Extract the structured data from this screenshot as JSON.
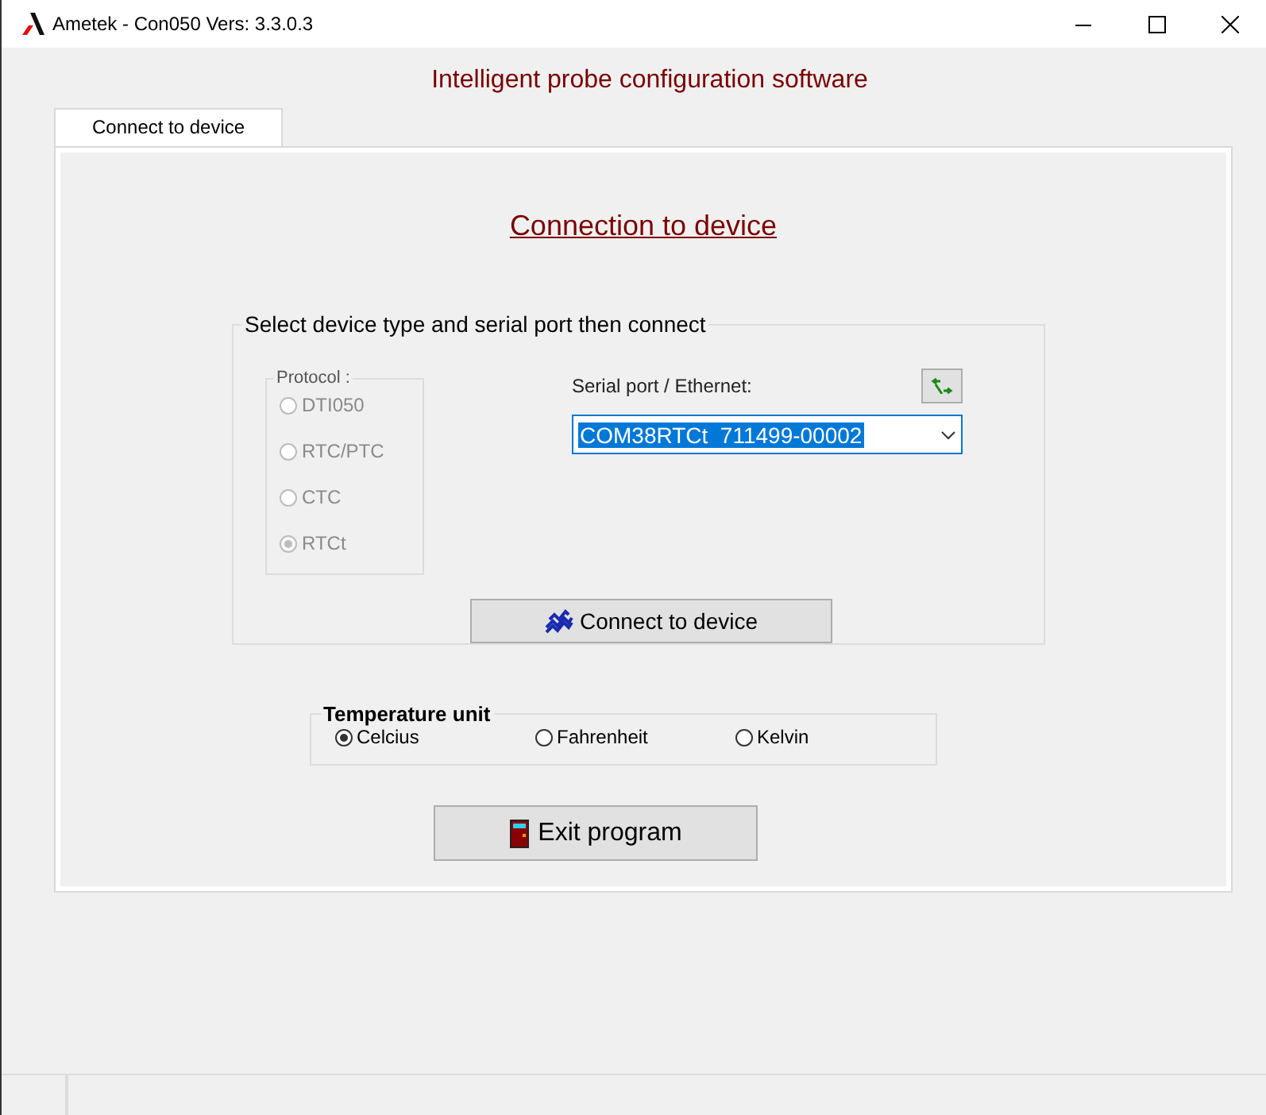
{
  "window": {
    "title": "Ametek - Con050 Vers: 3.3.0.3"
  },
  "heading": "Intelligent probe configuration software",
  "tabs": [
    {
      "label": "Connect to device",
      "selected": true
    }
  ],
  "panel_title": "Connection to device",
  "device_group": {
    "legend": "Select device type and serial port then connect",
    "protocol": {
      "legend": "Protocol :",
      "options": [
        {
          "label": "DTI050",
          "selected": false,
          "disabled": true
        },
        {
          "label": "RTC/PTC",
          "selected": false,
          "disabled": true
        },
        {
          "label": "CTC",
          "selected": false,
          "disabled": true
        },
        {
          "label": "RTCt",
          "selected": true,
          "disabled": true
        }
      ]
    },
    "port_label": "Serial port / Ethernet:",
    "port_value": "COM38RTCt  711499-00002",
    "connect_button": "Connect to device"
  },
  "temperature_group": {
    "legend": "Temperature unit",
    "options": [
      {
        "label": "Celcius",
        "selected": true
      },
      {
        "label": "Fahrenheit",
        "selected": false
      },
      {
        "label": "Kelvin",
        "selected": false
      }
    ]
  },
  "exit_button": "Exit program"
}
